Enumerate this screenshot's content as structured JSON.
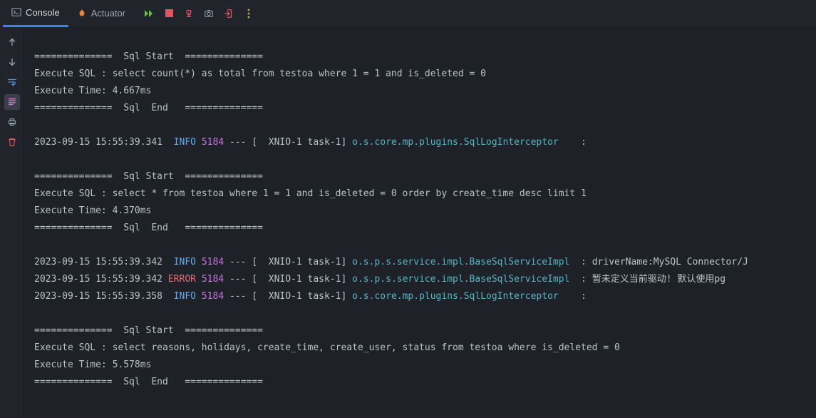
{
  "tabs": {
    "console": "Console",
    "actuator": "Actuator"
  },
  "lines": [
    {
      "type": "blank"
    },
    {
      "type": "plain",
      "text": "==============  Sql Start  =============="
    },
    {
      "type": "plain",
      "text": "Execute SQL : select count(*) as total from testoa where 1 = 1 and is_deleted = 0"
    },
    {
      "type": "plain",
      "text": "Execute Time: 4.667ms"
    },
    {
      "type": "plain",
      "text": "==============  Sql  End   =============="
    },
    {
      "type": "blank"
    },
    {
      "type": "log",
      "ts": "2023-09-15 15:55:39.341",
      "level": "INFO",
      "pid": "5184",
      "thread": "[  XNIO-1 task-1]",
      "logger": "o.s.core.mp.plugins.SqlLogInterceptor   ",
      "msg": " :"
    },
    {
      "type": "blank"
    },
    {
      "type": "plain",
      "text": "==============  Sql Start  =============="
    },
    {
      "type": "plain",
      "text": "Execute SQL : select * from testoa where 1 = 1 and is_deleted = 0 order by create_time desc limit 1"
    },
    {
      "type": "plain",
      "text": "Execute Time: 4.370ms"
    },
    {
      "type": "plain",
      "text": "==============  Sql  End   =============="
    },
    {
      "type": "blank"
    },
    {
      "type": "log",
      "ts": "2023-09-15 15:55:39.342",
      "level": "INFO",
      "pid": "5184",
      "thread": "[  XNIO-1 task-1]",
      "logger": "o.s.p.s.service.impl.BaseSqlServiceImpl ",
      "msg": " : driverName:MySQL Connector/J"
    },
    {
      "type": "log",
      "ts": "2023-09-15 15:55:39.342",
      "level": "ERROR",
      "pid": "5184",
      "thread": "[  XNIO-1 task-1]",
      "logger": "o.s.p.s.service.impl.BaseSqlServiceImpl ",
      "msg": " : 暂未定义当前驱动! 默认使用pg"
    },
    {
      "type": "log",
      "ts": "2023-09-15 15:55:39.358",
      "level": "INFO",
      "pid": "5184",
      "thread": "[  XNIO-1 task-1]",
      "logger": "o.s.core.mp.plugins.SqlLogInterceptor   ",
      "msg": " :"
    },
    {
      "type": "blank"
    },
    {
      "type": "plain",
      "text": "==============  Sql Start  =============="
    },
    {
      "type": "plain",
      "text": "Execute SQL : select reasons, holidays, create_time, create_user, status from testoa where is_deleted = 0"
    },
    {
      "type": "plain",
      "text": "Execute Time: 5.578ms"
    },
    {
      "type": "plain",
      "text": "==============  Sql  End   =============="
    },
    {
      "type": "blank"
    }
  ]
}
